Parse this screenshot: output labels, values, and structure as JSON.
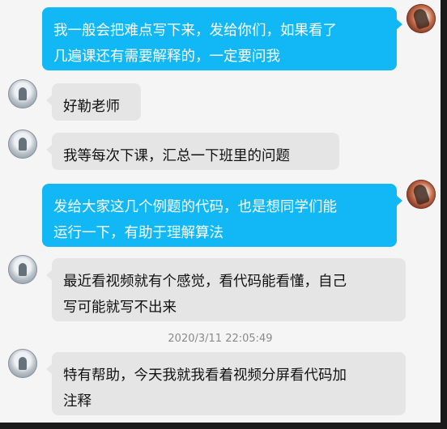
{
  "conversation": {
    "messages": [
      {
        "sender": "teacher",
        "side": "right",
        "text": "我一般会把难点写下来，发给你们，如果看了\n几遍课还有需要解释的，一定要问我"
      },
      {
        "sender": "student",
        "side": "left",
        "text": "好勒老师"
      },
      {
        "sender": "student",
        "side": "left",
        "text": "我等每次下课，汇总一下班里的问题"
      },
      {
        "sender": "teacher",
        "side": "right",
        "text": "发给大家这几个例题的代码，也是想同学们能\n运行一下，有助于理解算法"
      },
      {
        "sender": "student",
        "side": "left",
        "text": "最近看视频就有个感觉，看代码能看懂，自己\n写可能就写不出来"
      },
      {
        "sender": "student",
        "side": "left",
        "text": "特有帮助，今天我就我看着视频分屏看代码加\n注释"
      }
    ],
    "timestamp": "2020/3/11 22:05:49"
  },
  "colors": {
    "outgoing_bubble": "#12b7f5",
    "incoming_bubble": "#e5e5e5",
    "background": "#f5f5f5"
  }
}
